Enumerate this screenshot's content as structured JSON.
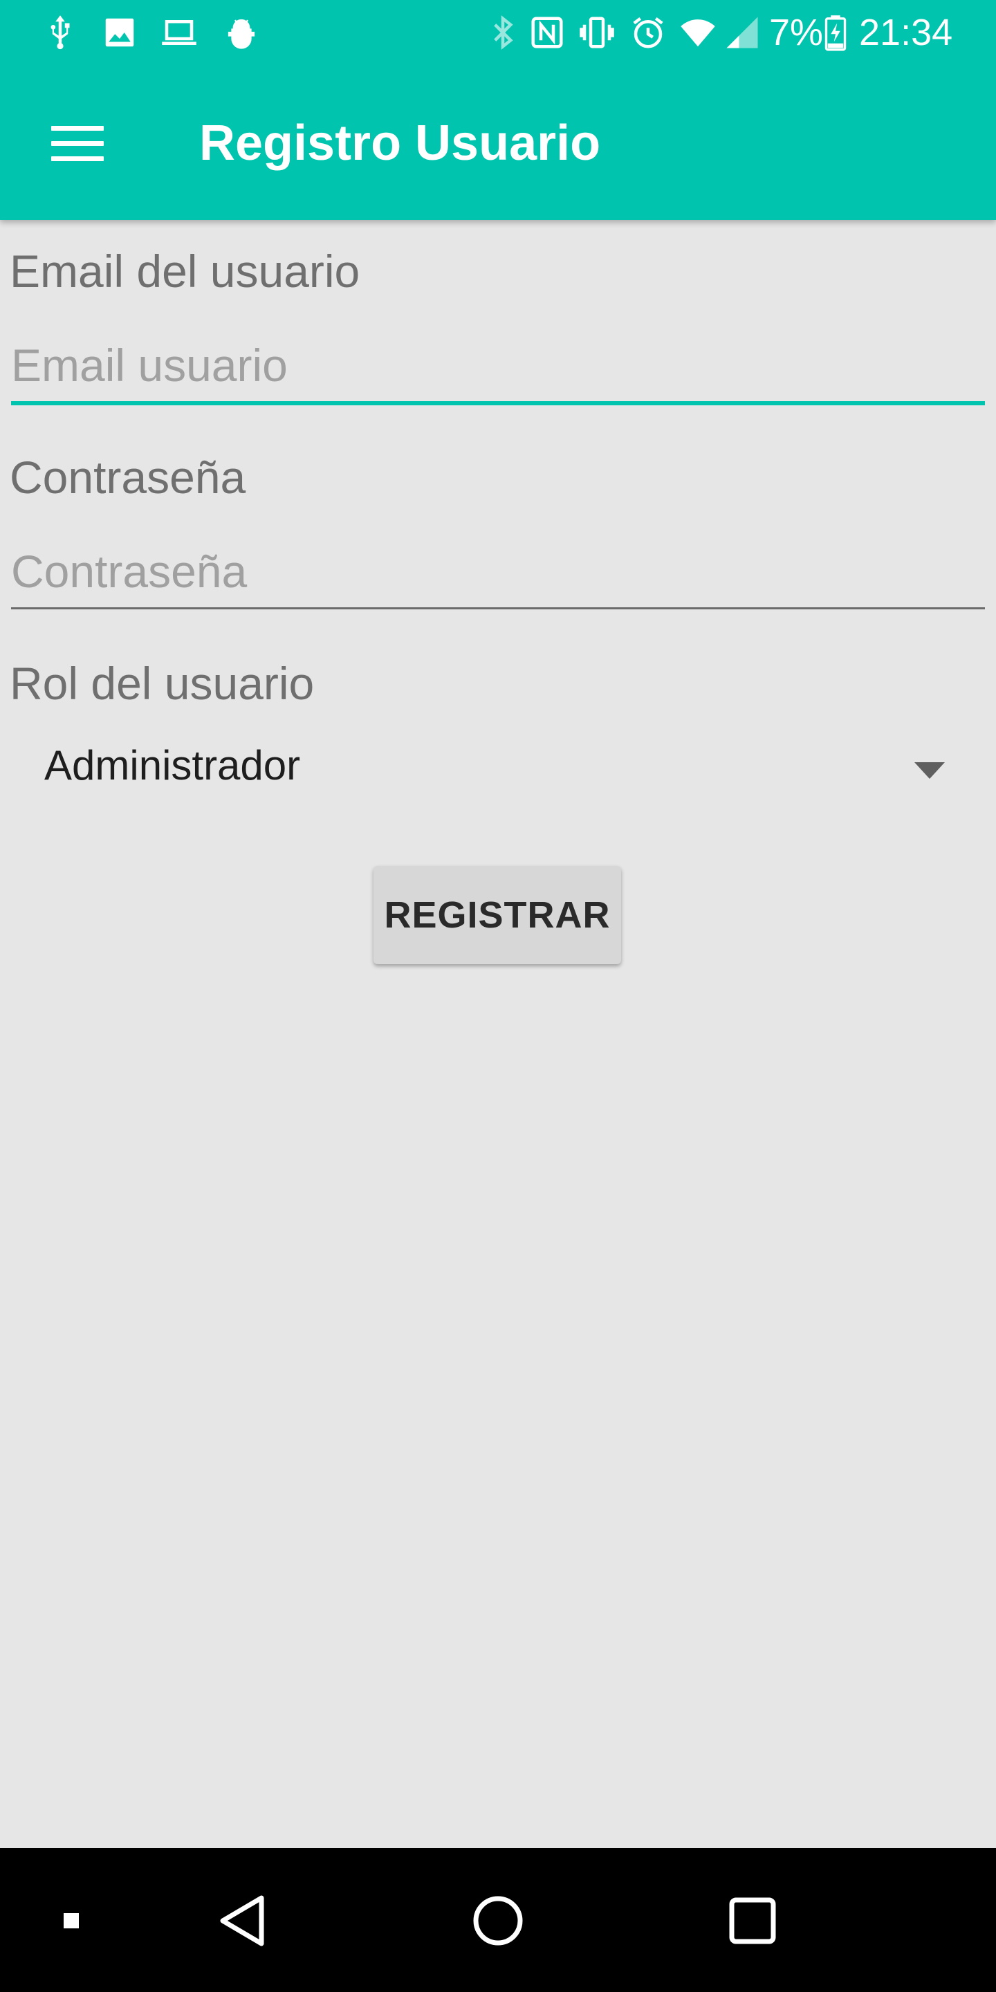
{
  "status_bar": {
    "left_icons": [
      "usb-icon",
      "image-icon",
      "laptop-icon",
      "android-debug-icon"
    ],
    "right_icons": [
      "bluetooth-icon",
      "nfc-icon",
      "vibrate-icon",
      "alarm-icon",
      "wifi-icon",
      "cell-signal-icon",
      "battery-charging-icon"
    ],
    "battery": "7%",
    "time": "21:34"
  },
  "app_bar": {
    "title": "Registro Usuario",
    "menu_icon": "hamburger-menu-icon",
    "background": "#00c4ae"
  },
  "form": {
    "email": {
      "label": "Email del usuario",
      "placeholder": "Email usuario",
      "value": ""
    },
    "password": {
      "label": "Contraseña",
      "placeholder": "Contraseña",
      "value": ""
    },
    "role": {
      "label": "Rol del usuario",
      "selected": "Administrador"
    },
    "submit_label": "REGISTRAR"
  },
  "colors": {
    "accent": "#00c4ae",
    "background": "#e6e6e6"
  },
  "nav_bar": {
    "buttons": [
      "dot-icon",
      "back-icon",
      "home-icon",
      "recents-icon"
    ]
  }
}
